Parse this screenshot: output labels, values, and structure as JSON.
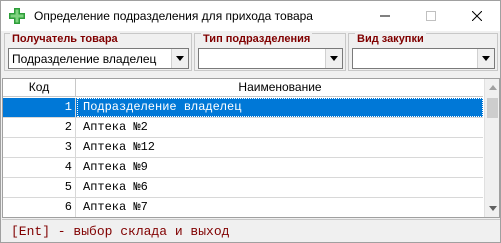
{
  "window": {
    "title": "Определение подразделения для прихода товара",
    "icon": "green-cross-pharmacy-icon"
  },
  "filters": {
    "recipient": {
      "label": "Получатель товара",
      "value": "Подразделение владелец"
    },
    "dept_type": {
      "label": "Тип подразделения",
      "value": ""
    },
    "purchase_type": {
      "label": "Вид закупки",
      "value": ""
    }
  },
  "grid": {
    "columns": {
      "code": "Код",
      "name": "Наименование"
    },
    "rows": [
      {
        "code": "1",
        "name": "Подразделение владелец"
      },
      {
        "code": "2",
        "name": "Аптека №2"
      },
      {
        "code": "3",
        "name": "Аптека №12"
      },
      {
        "code": "4",
        "name": "Аптека №9"
      },
      {
        "code": "5",
        "name": "Аптека №6"
      },
      {
        "code": "6",
        "name": "Аптека №7"
      }
    ]
  },
  "status": {
    "text": "[Ent] - выбор склада и выход"
  },
  "colors": {
    "selection": "#0078d7",
    "label_accent": "#800000",
    "icon_green": "#2e9e3a"
  }
}
